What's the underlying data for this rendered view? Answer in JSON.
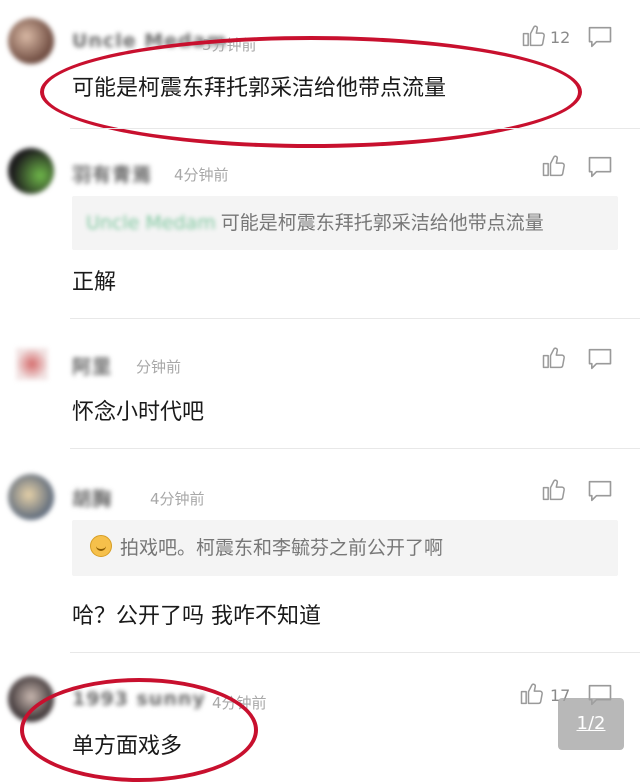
{
  "comments": [
    {
      "username": "Uncle Medam",
      "time": "5分钟前",
      "text": "可能是柯震东拜托郭采洁给他带点流量",
      "likes": "12"
    },
    {
      "username": "羽有青焉",
      "time": "4分钟前",
      "quote_user": "Uncle Medam",
      "quote_text": "可能是柯震东拜托郭采洁给他带点流量",
      "text": "正解"
    },
    {
      "username": "阿里",
      "time": "分钟前",
      "text": "怀念小时代吧"
    },
    {
      "username": "胡胸",
      "time": "4分钟前",
      "quote_text": "拍戏吧。柯震东和李毓芬之前公开了啊",
      "text": "哈？公开了吗 我咋不知道"
    },
    {
      "username": "1993 sunny",
      "time": "4分钟前",
      "text": "单方面戏多",
      "likes": "17"
    }
  ],
  "pager": {
    "label": "1/2"
  },
  "colors": {
    "highlight_ring": "#c8102e",
    "quote_name": "#7fc79f",
    "background": "#ffffff"
  },
  "icons": {
    "like": "thumbs-up-outline",
    "reply": "speech-bubble-outline",
    "emoji": "smiley-face"
  }
}
